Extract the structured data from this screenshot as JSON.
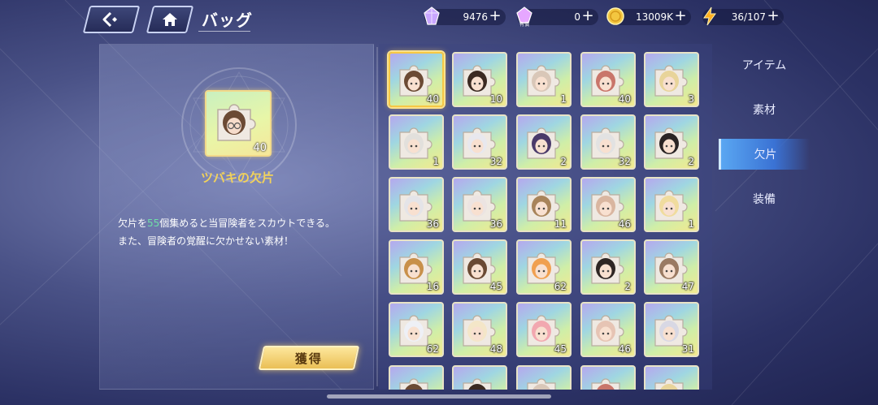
{
  "header": {
    "title": "バッグ",
    "back_icon": "back-arrow-icon",
    "home_icon": "home-icon"
  },
  "resources": {
    "crystal": {
      "value": "9476",
      "icon": "crystal-icon"
    },
    "paid_crystal": {
      "value": "0",
      "icon": "paid-crystal-icon",
      "sub_label": "有償"
    },
    "coin": {
      "value": "13009K",
      "icon": "coin-icon"
    },
    "stamina": {
      "value": "36/107",
      "icon": "lightning-icon"
    },
    "plus": "+"
  },
  "detail": {
    "count": "40",
    "name": "ツバキの欠片",
    "desc_part1": "欠片を",
    "desc_highlight": "55",
    "desc_part2": "個集めると当冒険者をスカウトできる。",
    "desc_line2": "また、冒険者の覚醒に欠かせない素材！",
    "obtain_button": "獲得"
  },
  "grid": {
    "counts": [
      "40",
      "10",
      "1",
      "40",
      "3",
      "1",
      "32",
      "2",
      "32",
      "2",
      "36",
      "36",
      "11",
      "46",
      "1",
      "16",
      "45",
      "62",
      "2",
      "47",
      "62",
      "48",
      "45",
      "46",
      "31"
    ],
    "selected_index": 0
  },
  "tabs": [
    {
      "label": "アイテム",
      "active": false
    },
    {
      "label": "素材",
      "active": false
    },
    {
      "label": "欠片",
      "active": true
    },
    {
      "label": "装備",
      "active": false
    }
  ],
  "colors": {
    "accent_gold": "#f2d25a",
    "highlight_green": "#6fe0a8",
    "tab_active": "#3a72d4"
  }
}
